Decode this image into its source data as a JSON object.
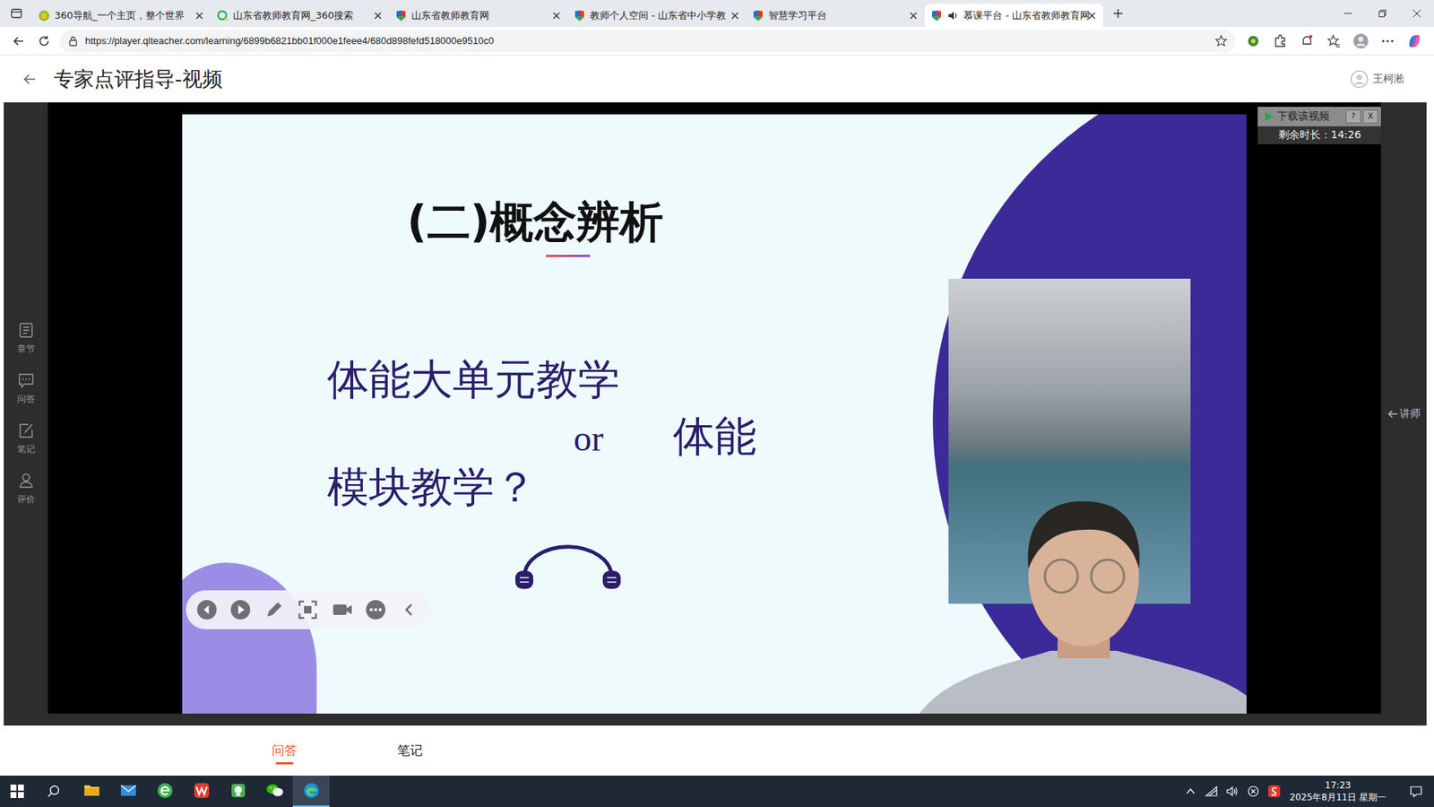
{
  "browser": {
    "tabs": [
      {
        "label": "360导航_一个主页，整个世界",
        "selected": false,
        "audio": false,
        "kind": "nav"
      },
      {
        "label": "山东省教师教育网_360搜索",
        "selected": false,
        "audio": false,
        "kind": "search"
      },
      {
        "label": "山东省教师教育网",
        "selected": false,
        "audio": false,
        "kind": "site"
      },
      {
        "label": "教师个人空间 - 山东省中小学教",
        "selected": false,
        "audio": false,
        "kind": "site"
      },
      {
        "label": "智慧学习平台",
        "selected": false,
        "audio": false,
        "kind": "site"
      },
      {
        "label": "慕课平台 - 山东省教师教育网",
        "selected": true,
        "audio": true,
        "kind": "site"
      }
    ],
    "url": "https://player.qlteacher.com/learning/6899b6821bb01f000e1feee4/680d898fefd518000e9510c0"
  },
  "header": {
    "title": "专家点评指导-视频",
    "user": "王柯淞"
  },
  "side_rail": [
    {
      "label": "章节"
    },
    {
      "label": "问答"
    },
    {
      "label": "笔记"
    },
    {
      "label": "评价"
    }
  ],
  "player": {
    "download": {
      "label": "下载该视频",
      "help": "?",
      "close": "X",
      "remaining": "剩余时长：14:26"
    },
    "slide": {
      "title": "(二)概念辨析",
      "line1": "体能大单元教学",
      "connector": "or",
      "line2": "体能",
      "line3": "模块教学？"
    },
    "lecturer_tab": "讲师"
  },
  "bottom_tabs": [
    {
      "label": "问答",
      "selected": true
    },
    {
      "label": "笔记",
      "selected": false
    }
  ],
  "taskbar": {
    "apps": [
      {
        "kind": "explorer",
        "active": false
      },
      {
        "kind": "mail",
        "active": false
      },
      {
        "kind": "browser360",
        "active": false
      },
      {
        "kind": "wps",
        "active": false
      },
      {
        "kind": "app",
        "active": false
      },
      {
        "kind": "wechat",
        "active": false
      },
      {
        "kind": "edge",
        "active": true
      }
    ],
    "time": "17:23",
    "date": "2025年8月11日 星期一"
  }
}
